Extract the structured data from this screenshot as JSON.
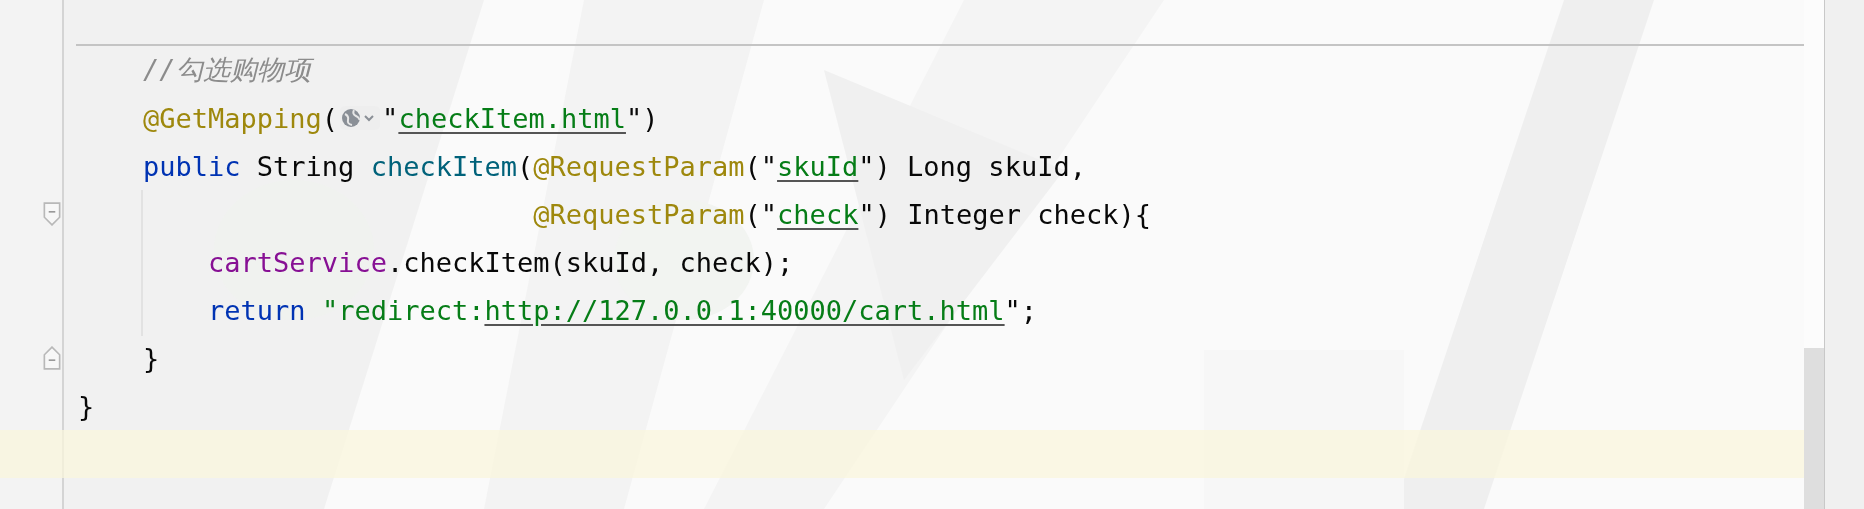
{
  "editor": {
    "lines": [
      {
        "tokens": [
          {
            "kind": "comment",
            "text": "//勾选购物项"
          }
        ]
      },
      {
        "tokens": [
          {
            "kind": "annotation",
            "text": "@GetMapping"
          },
          {
            "kind": "plain",
            "text": "("
          },
          {
            "kind": "inlay"
          },
          {
            "kind": "plain",
            "text": "\""
          },
          {
            "kind": "link",
            "text": "checkItem.html"
          },
          {
            "kind": "plain",
            "text": "\")"
          }
        ]
      },
      {
        "tokens": [
          {
            "kind": "keyword",
            "text": "public"
          },
          {
            "kind": "plain",
            "text": " String "
          },
          {
            "kind": "method",
            "text": "checkItem"
          },
          {
            "kind": "plain",
            "text": "("
          },
          {
            "kind": "annotation",
            "text": "@RequestParam"
          },
          {
            "kind": "plain",
            "text": "(\""
          },
          {
            "kind": "link",
            "text": "skuId"
          },
          {
            "kind": "plain",
            "text": "\") Long skuId,"
          }
        ]
      },
      {
        "fold_start": true,
        "tokens": [
          {
            "kind": "annotation",
            "text": "@RequestParam"
          },
          {
            "kind": "plain",
            "text": "(\""
          },
          {
            "kind": "link",
            "text": "check"
          },
          {
            "kind": "plain",
            "text": "\") Integer check){"
          }
        ]
      },
      {
        "tokens": [
          {
            "kind": "member",
            "text": "cartService"
          },
          {
            "kind": "plain",
            "text": ".checkItem(skuId, check);"
          }
        ]
      },
      {
        "tokens": [
          {
            "kind": "keyword",
            "text": "return"
          },
          {
            "kind": "string",
            "text": " \"redirect:"
          },
          {
            "kind": "link",
            "text": "http://127.0.0.1:40000/cart.html"
          },
          {
            "kind": "plain",
            "text": "\";"
          }
        ]
      },
      {
        "fold_end": true,
        "tokens": [
          {
            "kind": "plain",
            "text": "}"
          }
        ]
      },
      {
        "tokens": [
          {
            "kind": "plain",
            "text": "}"
          }
        ]
      },
      {
        "current": true
      }
    ]
  }
}
